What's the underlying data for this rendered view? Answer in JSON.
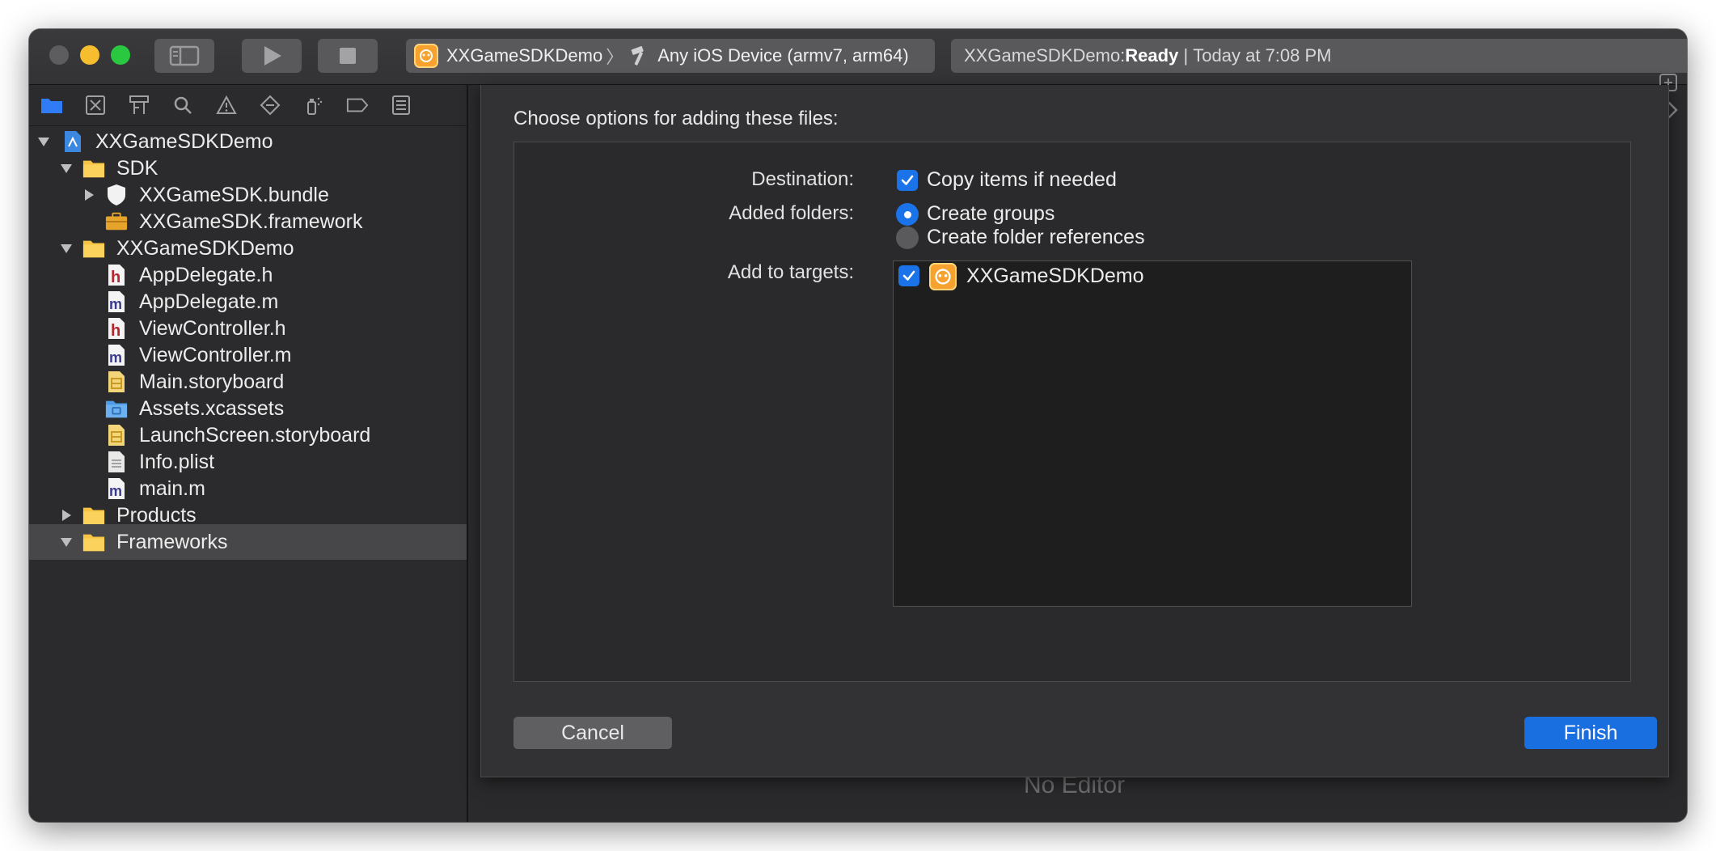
{
  "toolbar": {
    "scheme_name": "XXGameSDKDemo",
    "separator": "〉",
    "destination": "Any iOS Device (armv7, arm64)",
    "status_project": "XXGameSDKDemo: ",
    "status_state": "Ready",
    "status_sep": " | ",
    "status_time": "Today at 7:08 PM"
  },
  "navigator": {
    "tabs": [
      "folder-icon",
      "source-control-icon",
      "hierarchy-icon",
      "search-icon",
      "warning-icon",
      "test-diamond-icon",
      "debug-spray-icon",
      "breakpoint-icon",
      "report-icon"
    ],
    "items": [
      {
        "label": "XXGameSDKDemo",
        "icon": "project-file-icon",
        "level": 0,
        "disclosure": "open"
      },
      {
        "label": "SDK",
        "icon": "folder-icon",
        "level": 1,
        "disclosure": "open"
      },
      {
        "label": "XXGameSDK.bundle",
        "icon": "bundle-icon",
        "level": 2,
        "disclosure": "closed"
      },
      {
        "label": "XXGameSDK.framework",
        "icon": "framework-icon",
        "level": 2,
        "disclosure": "none"
      },
      {
        "label": "XXGameSDKDemo",
        "icon": "folder-icon",
        "level": 1,
        "disclosure": "open"
      },
      {
        "label": "AppDelegate.h",
        "icon": "header-file-icon",
        "level": 2,
        "disclosure": "none"
      },
      {
        "label": "AppDelegate.m",
        "icon": "objc-file-icon",
        "level": 2,
        "disclosure": "none"
      },
      {
        "label": "ViewController.h",
        "icon": "header-file-icon",
        "level": 2,
        "disclosure": "none"
      },
      {
        "label": "ViewController.m",
        "icon": "objc-file-icon",
        "level": 2,
        "disclosure": "none"
      },
      {
        "label": "Main.storyboard",
        "icon": "storyboard-icon",
        "level": 2,
        "disclosure": "none"
      },
      {
        "label": "Assets.xcassets",
        "icon": "assets-folder-icon",
        "level": 2,
        "disclosure": "none"
      },
      {
        "label": "LaunchScreen.storyboard",
        "icon": "storyboard-icon",
        "level": 2,
        "disclosure": "none"
      },
      {
        "label": "Info.plist",
        "icon": "plist-icon",
        "level": 2,
        "disclosure": "none"
      },
      {
        "label": "main.m",
        "icon": "objc-file-icon",
        "level": 2,
        "disclosure": "none"
      },
      {
        "label": "Products",
        "icon": "folder-icon",
        "level": 1,
        "disclosure": "closed"
      },
      {
        "label": "Frameworks",
        "icon": "folder-icon",
        "level": 1,
        "disclosure": "open",
        "selected": true
      }
    ]
  },
  "editor": {
    "placeholder": "No Editor"
  },
  "sheet": {
    "title": "Choose options for adding these files:",
    "destination_label": "Destination:",
    "copy_items": "Copy items if needed",
    "copy_checked": true,
    "added_folders_label": "Added folders:",
    "create_groups": "Create groups",
    "create_folder_refs": "Create folder references",
    "selected_option": "Create groups",
    "targets_label": "Add to targets:",
    "target_name": "XXGameSDKDemo",
    "target_checked": true,
    "cancel_label": "Cancel",
    "finish_label": "Finish"
  },
  "colors": {
    "accent": "#1a73e8",
    "window_bg": "#1e1e1f",
    "sidebar_bg": "#2b2b2d",
    "selection": "#474749",
    "app_icon": "#f7a12e"
  }
}
